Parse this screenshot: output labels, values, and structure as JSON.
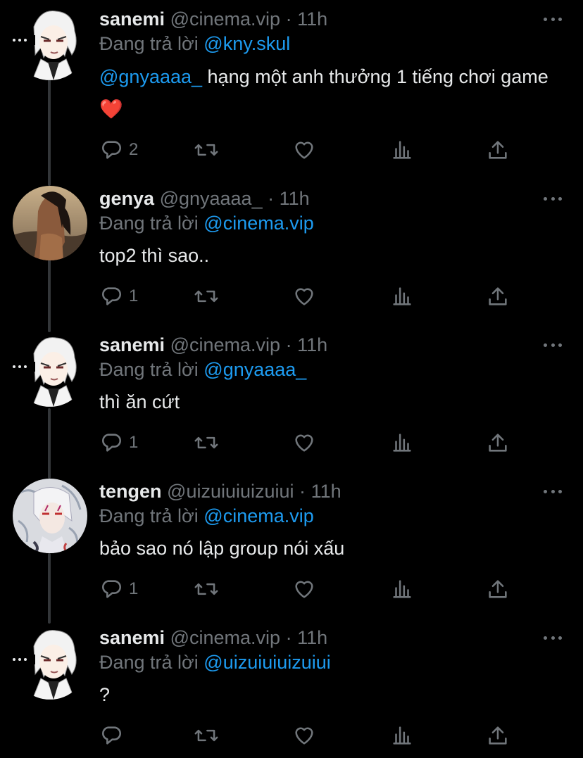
{
  "colors": {
    "background": "#000000",
    "text": "#e7e9ea",
    "secondary": "#71767b",
    "accent": "#1d9bf0",
    "heart": "#f4212e",
    "thread_line": "#333639"
  },
  "tweets": [
    {
      "name": "sanemi",
      "handle": "@cinema.vip",
      "sep": "·",
      "time": "11h",
      "reply_prefix": "Đang trả lời",
      "reply_to": "@kny.skul",
      "body_mention": "@gnyaaaa_",
      "body_text": " hạng một anh thưởng 1 tiếng chơi game",
      "body_emoji": "❤️",
      "reply_count": "2",
      "avatar": "sanemi-avatar",
      "avatar_menu": "ellipsis-icon"
    },
    {
      "name": "genya",
      "handle": "@gnyaaaa_",
      "sep": "·",
      "time": "11h",
      "reply_prefix": "Đang trả lời",
      "reply_to": "@cinema.vip",
      "body_text": "top2 thì sao..",
      "reply_count": "1",
      "avatar": "genya-avatar"
    },
    {
      "name": "sanemi",
      "handle": "@cinema.vip",
      "sep": "·",
      "time": "11h",
      "reply_prefix": "Đang trả lời",
      "reply_to": "@gnyaaaa_",
      "body_text": "thì ăn cứt",
      "reply_count": "1",
      "avatar": "sanemi-avatar"
    },
    {
      "name": "tengen",
      "handle": "@uizuiuiuizuiui",
      "sep": "·",
      "time": "11h",
      "reply_prefix": "Đang trả lời",
      "reply_to": "@cinema.vip",
      "body_text": "bảo sao nó lập group nói xấu",
      "reply_count": "1",
      "avatar": "tengen-avatar"
    },
    {
      "name": "sanemi",
      "handle": "@cinema.vip",
      "sep": "·",
      "time": "11h",
      "reply_prefix": "Đang trả lời",
      "reply_to": "@uizuiuiuizuiui",
      "body_text": "?",
      "reply_count": "",
      "avatar": "sanemi-avatar"
    }
  ],
  "action_icons": [
    "reply-icon",
    "retweet-icon",
    "like-icon",
    "analytics-icon",
    "share-icon"
  ]
}
